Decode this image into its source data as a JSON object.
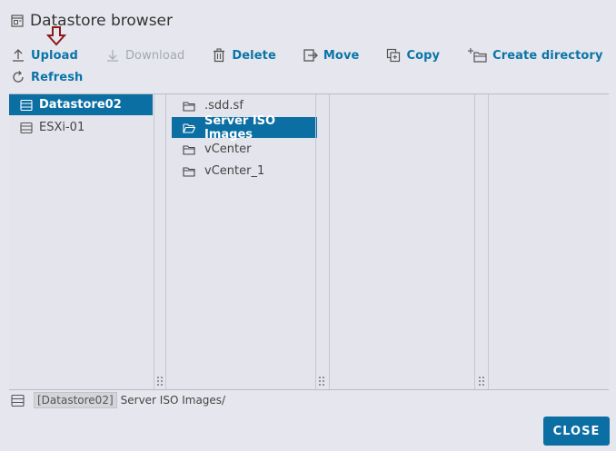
{
  "window": {
    "title": "Datastore browser",
    "title_icon": "datastore-browser-icon"
  },
  "toolbar": {
    "upload": "Upload",
    "download": "Download",
    "delete": "Delete",
    "move": "Move",
    "copy": "Copy",
    "create_directory": "Create directory",
    "refresh": "Refresh"
  },
  "tree": {
    "items": [
      {
        "label": "Datastore02",
        "icon": "datastore-icon",
        "selected": true
      },
      {
        "label": "ESXi-01",
        "icon": "host-icon",
        "selected": false
      }
    ]
  },
  "folders": {
    "items": [
      {
        "label": ".sdd.sf",
        "icon": "folder-icon",
        "selected": false
      },
      {
        "label": "Server ISO Images",
        "icon": "folder-open-icon",
        "selected": true
      },
      {
        "label": "vCenter",
        "icon": "folder-icon",
        "selected": false
      },
      {
        "label": "vCenter_1",
        "icon": "folder-icon",
        "selected": false
      }
    ]
  },
  "path": {
    "datastore": "[Datastore02]",
    "folder": "Server ISO Images/"
  },
  "footer": {
    "close": "CLOSE"
  },
  "colors": {
    "accent": "#0b6fa4",
    "link": "#0a74a8",
    "marker": "#8b1a1a"
  }
}
